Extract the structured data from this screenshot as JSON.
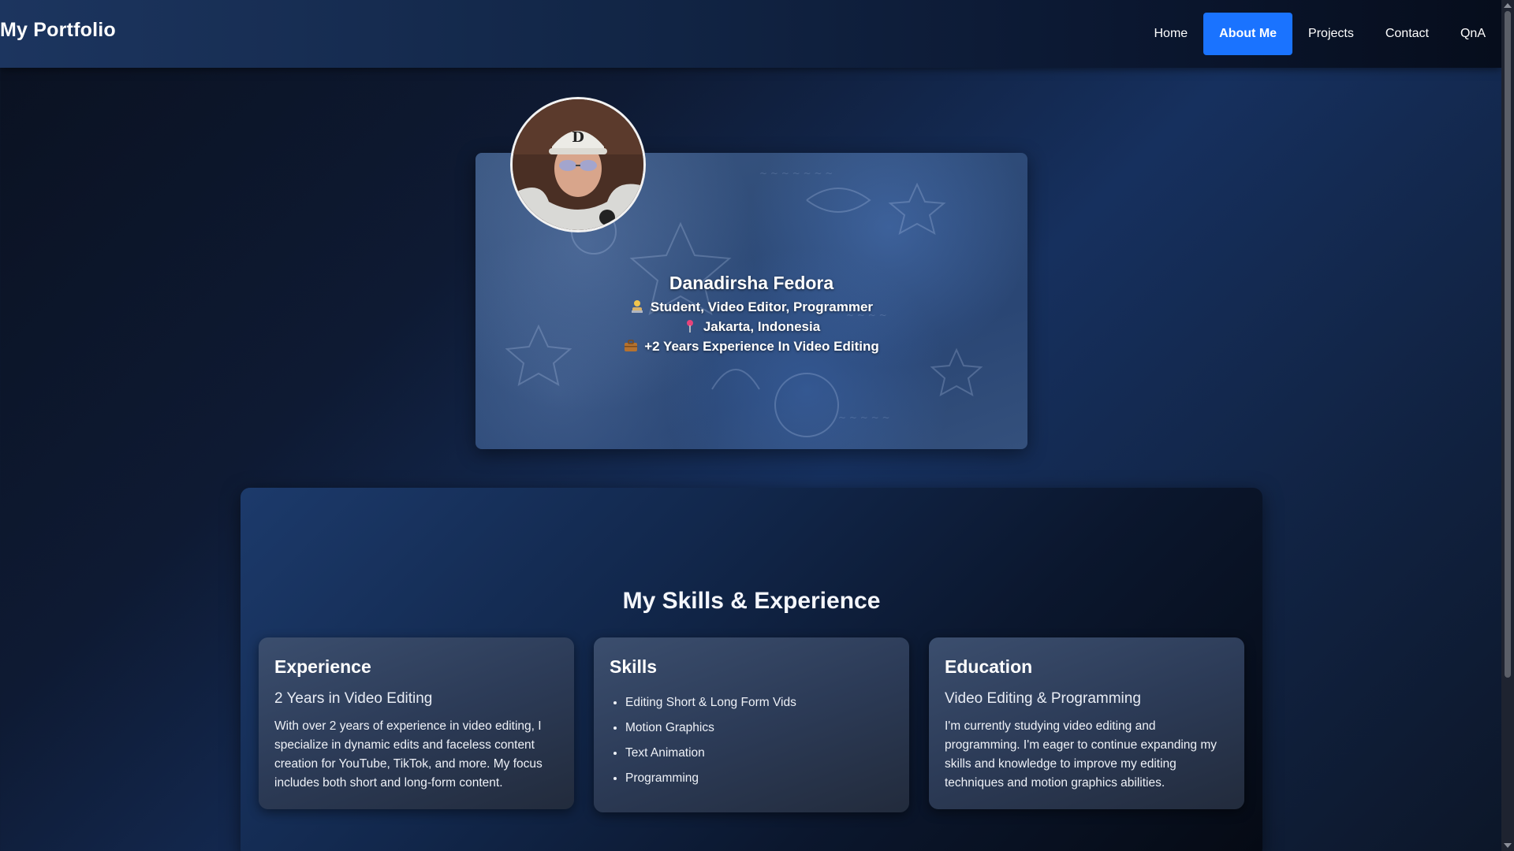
{
  "header": {
    "brand": "My Portfolio",
    "nav": [
      {
        "label": "Home",
        "active": false
      },
      {
        "label": "About Me",
        "active": true
      },
      {
        "label": "Projects",
        "active": false
      },
      {
        "label": "Contact",
        "active": false
      },
      {
        "label": "QnA",
        "active": false
      }
    ]
  },
  "profile": {
    "name": "Danadirsha Fedora",
    "role": "Student, Video Editor, Programmer",
    "location": "Jakarta, Indonesia",
    "experience": "+2 Years Experience In Video Editing",
    "role_icon": "technologist-icon",
    "location_icon": "pin-icon",
    "experience_icon": "briefcase-icon"
  },
  "skills_section": {
    "title": "My Skills & Experience",
    "cards": [
      {
        "title": "Experience",
        "subtitle": "2 Years in Video Editing",
        "text": "With over 2 years of experience in video editing, I specialize in dynamic edits and faceless content creation for YouTube, TikTok, and more. My focus includes both short and long-form content."
      },
      {
        "title": "Skills",
        "items": [
          "Editing Short & Long Form Vids",
          "Motion Graphics",
          "Text Animation",
          "Programming"
        ]
      },
      {
        "title": "Education",
        "subtitle": "Video Editing & Programming",
        "text": "I'm currently studying video editing and programming. I'm eager to continue expanding my skills and knowledge to improve my editing techniques and motion graphics abilities."
      }
    ]
  },
  "colors": {
    "accent": "#1a73ff",
    "background_dark": "#0a1120",
    "card": "#2c3b57"
  }
}
